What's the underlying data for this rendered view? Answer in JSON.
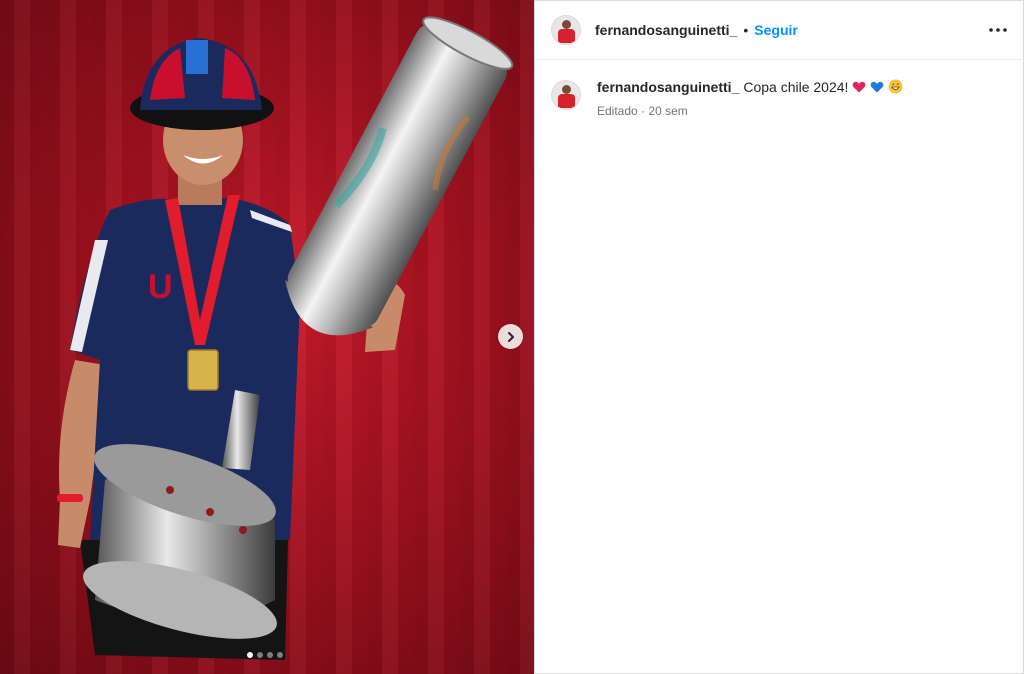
{
  "post": {
    "author": "fernandosanguinetti_",
    "separator": "•",
    "follow_label": "Seguir",
    "caption": "Copa chile 2024!",
    "caption_emojis": [
      "red-heart-icon",
      "blue-heart-icon",
      "grinning-face-icon"
    ],
    "edited_label": "Editado",
    "meta_separator": "·",
    "time_ago": "20 sem"
  },
  "carousel": {
    "slide_count": 4,
    "active_index": 0
  },
  "colors": {
    "follow": "#0095f6",
    "background_red": "#a3111f",
    "jersey_blue": "#1b2a5c"
  }
}
